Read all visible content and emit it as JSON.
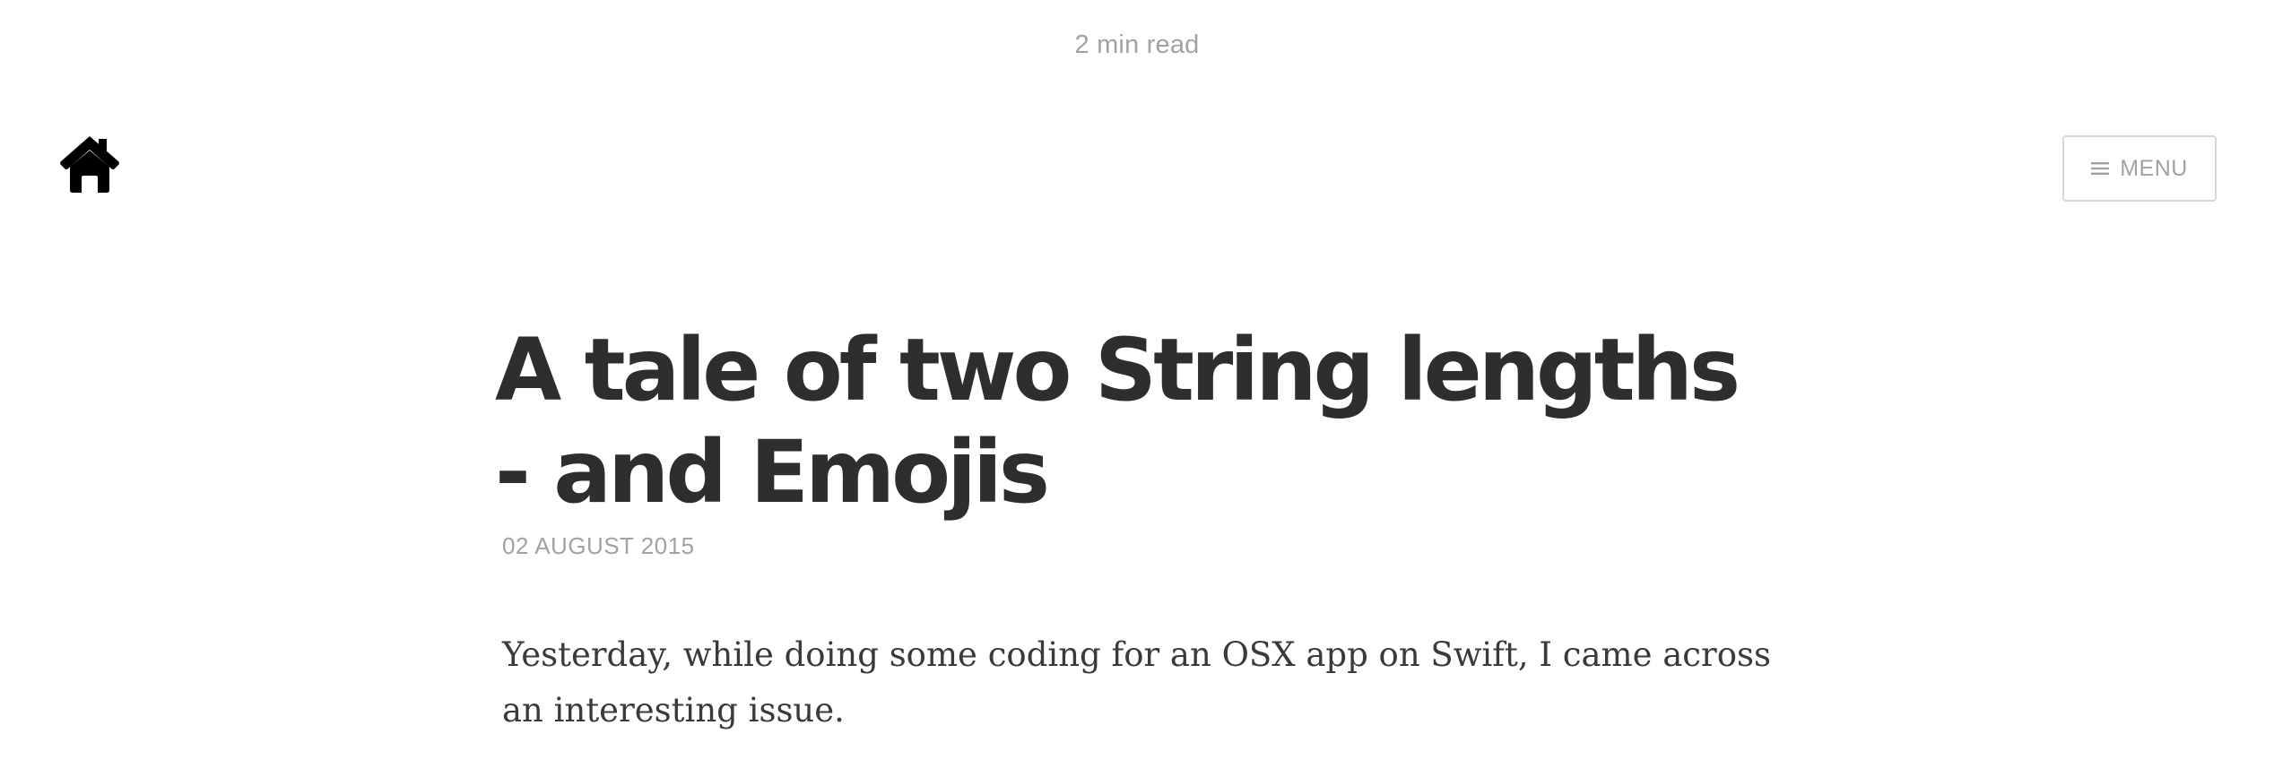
{
  "header": {
    "read_time": "2 min read",
    "home_icon": "home-icon",
    "menu_icon": "hamburger-menu-icon",
    "menu_label": "MENU"
  },
  "post": {
    "title": "A tale of two String lengths - and Emojis",
    "date": "02 AUGUST 2015",
    "body_first_paragraph": "Yesterday, while doing some coding for an OSX app on Swift, I came across an interesting issue."
  },
  "colors": {
    "title": "#2e2e2e",
    "muted": "#9ea3a8",
    "body": "#3a3a3a",
    "border": "#d3d8dc"
  }
}
